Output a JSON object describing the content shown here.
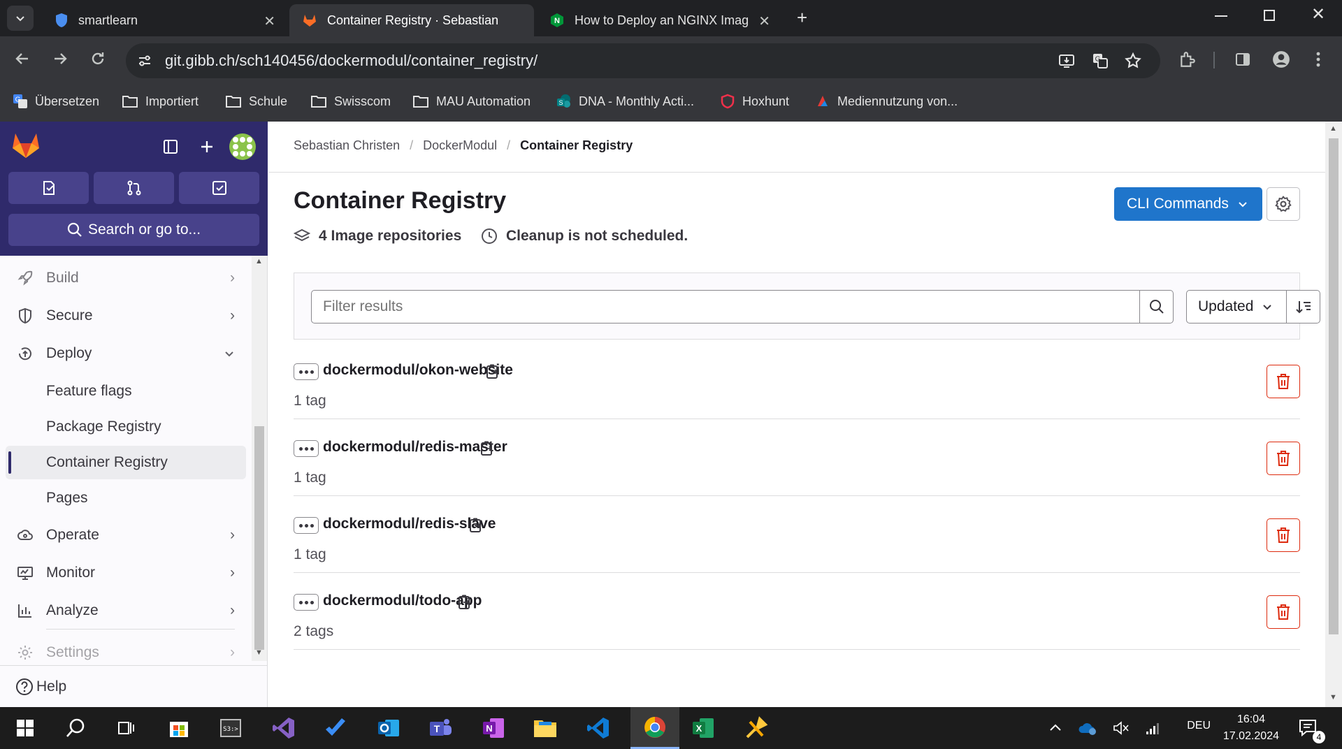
{
  "browser": {
    "tabs": [
      {
        "title": "smartlearn"
      },
      {
        "title": "Container Registry · Sebastian C"
      },
      {
        "title": "How to Deploy an NGINX Imag"
      }
    ],
    "url": "git.gibb.ch/sch140456/dockermodul/container_registry/",
    "bookmarks": [
      "Übersetzen",
      "Importiert",
      "Schule",
      "Swisscom",
      "MAU Automation",
      "DNA - Monthly Acti...",
      "Hoxhunt",
      "Mediennutzung von..."
    ]
  },
  "sidebar": {
    "search_label": "Search or go to...",
    "items": [
      {
        "label": "Build",
        "icon": "rocket-icon"
      },
      {
        "label": "Secure",
        "icon": "shield-icon"
      },
      {
        "label": "Deploy",
        "icon": "deploy-icon"
      },
      {
        "label": "Operate",
        "icon": "cloud-icon"
      },
      {
        "label": "Monitor",
        "icon": "monitor-icon"
      },
      {
        "label": "Analyze",
        "icon": "chart-icon"
      },
      {
        "label": "Settings",
        "icon": "gear-icon"
      }
    ],
    "deploy_subitems": [
      "Feature flags",
      "Package Registry",
      "Container Registry",
      "Pages"
    ],
    "help_label": "Help"
  },
  "breadcrumb": [
    "Sebastian Christen",
    "DockerModul",
    "Container Registry"
  ],
  "page": {
    "title": "Container Registry",
    "repo_count": "4 Image repositories",
    "cleanup": "Cleanup is not scheduled.",
    "cli_label": "CLI Commands",
    "filter_placeholder": "Filter results",
    "sort_label": "Updated"
  },
  "repositories": [
    {
      "name": "dockermodul/okon-website",
      "tags": "1 tag"
    },
    {
      "name": "dockermodul/redis-master",
      "tags": "1 tag"
    },
    {
      "name": "dockermodul/redis-slave",
      "tags": "1 tag"
    },
    {
      "name": "dockermodul/todo-app",
      "tags": "2 tags"
    }
  ],
  "taskbar": {
    "language": "DEU",
    "time": "16:04",
    "date": "17.02.2024",
    "notifications": "4"
  },
  "colors": {
    "sidebar_header": "#2f2a6b",
    "primary_button": "#1f75cb",
    "danger": "#dd2b0e"
  }
}
